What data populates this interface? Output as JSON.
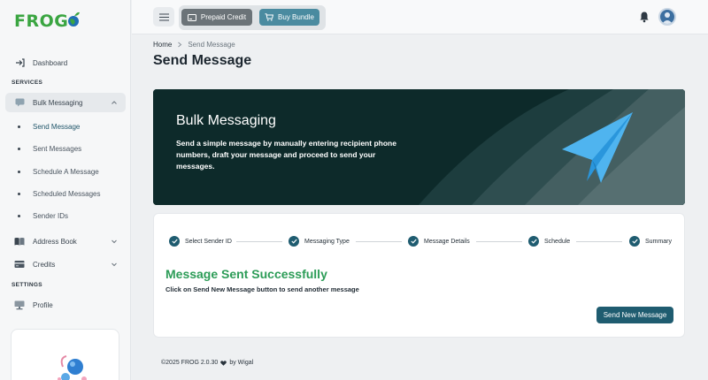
{
  "brand": {
    "logo_text": "FROG",
    "accent": "#3aa541"
  },
  "sidebar": {
    "dashboard": {
      "label": "Dashboard",
      "icon": "sign-in-icon"
    },
    "section_services": "SERVICES",
    "bulk_messaging": {
      "label": "Bulk Messaging",
      "icon": "message-icon",
      "expanded": true
    },
    "sub_items": [
      {
        "label": "Send Message",
        "current": true
      },
      {
        "label": "Sent Messages"
      },
      {
        "label": "Schedule A Message"
      },
      {
        "label": "Scheduled Messages"
      },
      {
        "label": "Sender IDs"
      }
    ],
    "address_book": {
      "label": "Address Book",
      "icon": "book-icon"
    },
    "credits": {
      "label": "Credits",
      "icon": "credit-card-icon"
    },
    "section_settings": "SETTINGS",
    "profile": {
      "label": "Profile",
      "icon": "profile-icon"
    }
  },
  "topbar": {
    "prepaid_label": "Prepaid Credit",
    "bundle_label": "Buy Bundle",
    "prepaid_color": "#6b7378",
    "bundle_color": "#4a8ba0"
  },
  "breadcrumb": {
    "home": "Home",
    "current": "Send Message"
  },
  "page_title": "Send Message",
  "hero": {
    "title": "Bulk Messaging",
    "description": "Send a simple message by manually entering recipient phone numbers, draft your message and proceed to send your messages."
  },
  "steps": [
    {
      "label": "Select Sender ID",
      "done": true
    },
    {
      "label": "Messaging Type",
      "done": true
    },
    {
      "label": "Message Details",
      "done": true
    },
    {
      "label": "Schedule",
      "done": true
    },
    {
      "label": "Summary",
      "done": true
    }
  ],
  "result": {
    "title": "Message Sent Successfully",
    "subtitle": "Click on Send New Message button to send another message",
    "button_label": "Send New Message",
    "success_color": "#2c9c57"
  },
  "footer": {
    "copyright": "©2025 FROG 2.0.30",
    "by": "by Wigal"
  }
}
